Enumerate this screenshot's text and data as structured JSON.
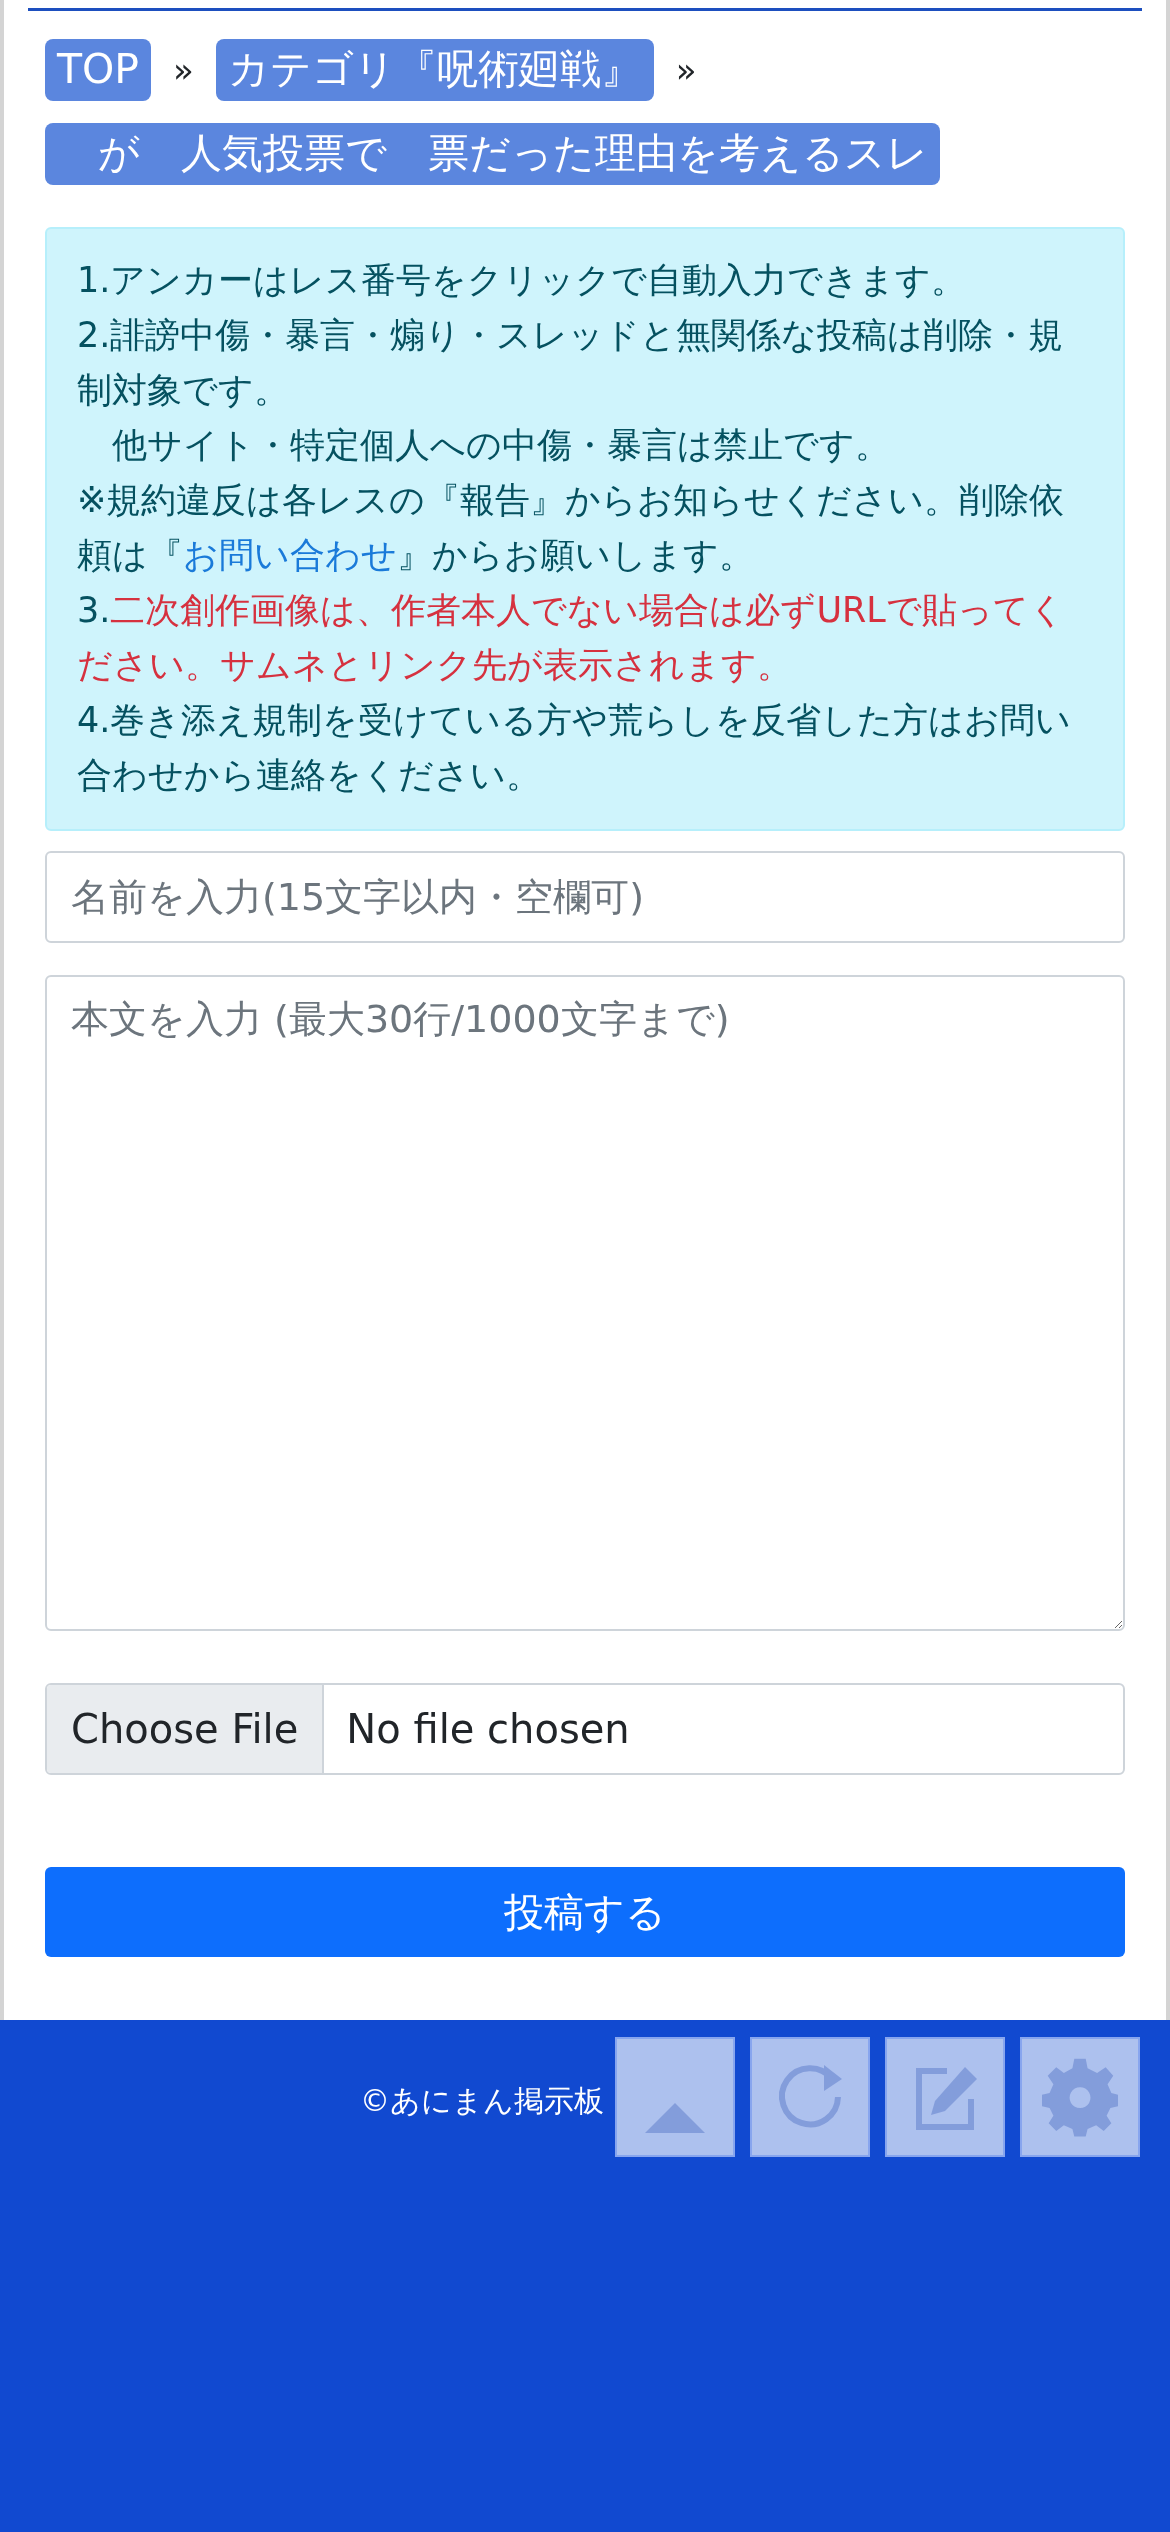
{
  "breadcrumb": [
    {
      "kind": "link",
      "label": "TOP"
    },
    {
      "kind": "separator",
      "label": "»"
    },
    {
      "kind": "link",
      "label": "カテゴリ『呪術廻戦』"
    },
    {
      "kind": "separator",
      "label": "»"
    },
    {
      "kind": "link",
      "label": "　が　人気投票で　票だった理由を考えるスレ"
    }
  ],
  "notice": [
    {
      "segments": [
        {
          "kind": "plain",
          "text": "1.アンカーはレス番号をクリックで自動入力できます。"
        }
      ]
    },
    {
      "segments": [
        {
          "kind": "plain",
          "text": "2.誹謗中傷・暴言・煽り・スレッドと無関係な投稿は削除・規制対象です。"
        }
      ]
    },
    {
      "segments": [
        {
          "kind": "plain",
          "text": "　他サイト・特定個人への中傷・暴言は禁止です。"
        }
      ]
    },
    {
      "segments": [
        {
          "kind": "plain",
          "text": "※規約違反は各レスの『報告』からお知らせください。削除依頼は『"
        },
        {
          "kind": "link",
          "text": "お問い合わせ"
        },
        {
          "kind": "plain",
          "text": "』からお願いします。"
        }
      ]
    },
    {
      "segments": [
        {
          "kind": "plain",
          "text": "3."
        },
        {
          "kind": "warning",
          "text": "二次創作画像は、作者本人でない場合は必ずURLで貼ってください。サムネとリンク先が表示されます。"
        }
      ]
    },
    {
      "segments": [
        {
          "kind": "plain",
          "text": "4.巻き添え規制を受けている方や荒らしを反省した方はお問い合わせから連絡をください。"
        }
      ]
    }
  ],
  "name_field": {
    "placeholder": "名前を入力(15文字以内・空欄可)"
  },
  "body_field": {
    "placeholder": "本文を入力 (最大30行/1000文字まで)"
  },
  "file_input": {
    "button": "Choose File",
    "status": "No file chosen"
  },
  "submit_button": "投稿する",
  "footer": {
    "copyright": "©あにまん掲示板"
  },
  "floating_buttons": [
    {
      "kind": "scroll-top"
    },
    {
      "kind": "reload"
    },
    {
      "kind": "edit"
    },
    {
      "kind": "settings"
    }
  ]
}
